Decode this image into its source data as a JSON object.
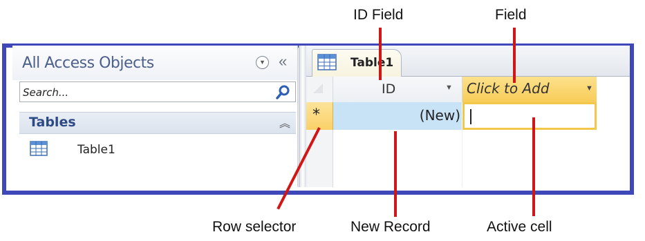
{
  "annotations": {
    "id_field": "ID Field",
    "field": "Field",
    "row_selector": "Row selector",
    "new_record": "New Record",
    "active_cell": "Active cell"
  },
  "navigation_pane": {
    "title": "All Access Objects",
    "search_placeholder": "Search...",
    "group_label": "Tables",
    "items": [
      {
        "label": "Table1",
        "icon": "table-icon"
      }
    ]
  },
  "document": {
    "tab_label": "Table1",
    "columns": [
      {
        "label": "ID"
      },
      {
        "label": "Click to Add"
      }
    ],
    "new_row": {
      "selector_symbol": "*",
      "id_value": "(New)",
      "active_value": ""
    }
  },
  "colors": {
    "frame_border": "#3f48b8",
    "pointer_line": "#d01616",
    "selection_yellow": "#f8cc58",
    "id_cell_blue": "#c9e3f6"
  }
}
